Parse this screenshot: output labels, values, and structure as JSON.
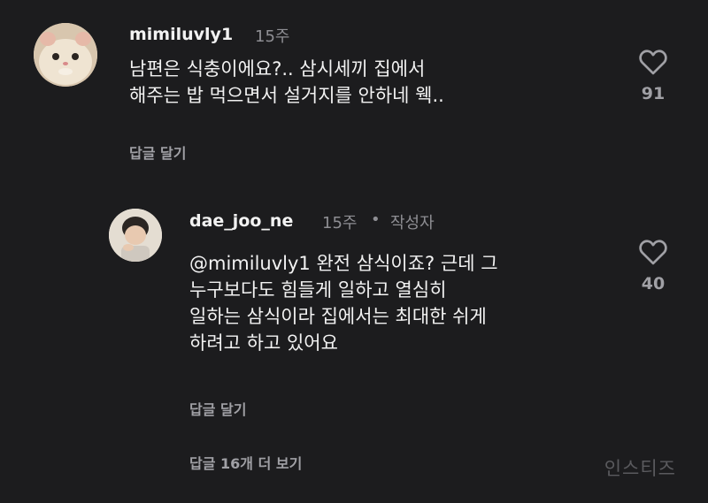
{
  "comments": [
    {
      "username": "mimiluvly1",
      "time": "15주",
      "lines": [
        "남편은 식충이에요?.. 삼시세끼 집에서",
        "해주는 밥 먹으면서 설거지를 안하네 웩.."
      ],
      "reply_label": "답글 달기",
      "likes": "91",
      "icon": "heart-outline-icon"
    },
    {
      "username": "dae_joo_ne",
      "time": "15주",
      "separator": "•",
      "author_badge": "작성자",
      "mention": "@mimiluvly1",
      "lines": [
        " 완전 삼식이죠? 근데 그",
        "누구보다도 힘들게 일하고 열심히",
        "일하는 삼식이라 집에서는 최대한 쉬게",
        "하려고 하고 있어요"
      ],
      "reply_label": "답글 달기",
      "likes": "40",
      "icon": "heart-outline-icon"
    }
  ],
  "view_replies": "답글 16개 더 보기",
  "watermark": "인스티즈",
  "colors": {
    "background": "#1c1c1e",
    "text": "#f2f2f2",
    "muted": "#8e8e93"
  }
}
